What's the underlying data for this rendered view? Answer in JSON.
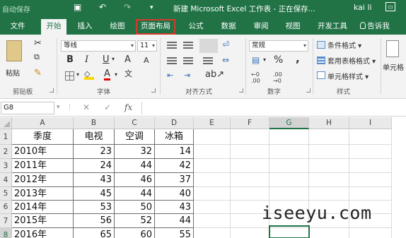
{
  "titlebar": {
    "autosave": "自动保存",
    "doc_title": "新建 Microsoft Excel 工作表 - 正在保存...",
    "user": "kai li"
  },
  "tabs": [
    "文件",
    "开始",
    "插入",
    "绘图",
    "页面布局",
    "公式",
    "数据",
    "审阅",
    "视图",
    "开发工具",
    "告诉我"
  ],
  "ribbon": {
    "paste_label": "粘贴",
    "clipboard_label": "剪贴板",
    "font_name": "等线",
    "font_size": "11",
    "bold": "B",
    "italic": "I",
    "underline": "U",
    "grow_font": "A",
    "shrink_font": "A",
    "font_color_glyph": "A",
    "phonetic_glyph": "文",
    "font_label": "字体",
    "alignment_label": "对齐方式",
    "number_format": "常规",
    "percent": "%",
    "comma": ",",
    "inc_decimal": "←0 .00",
    "dec_decimal": ".00 →0",
    "number_label": "数字",
    "conditional_format": "条件格式",
    "format_as_table": "套用表格格式",
    "cell_styles": "单元格样式",
    "styles_label": "样式",
    "cells_label": "单元格"
  },
  "formula_bar": {
    "name_box": "G8",
    "cancel": "✕",
    "enter": "✓",
    "fx": "fx",
    "formula": ""
  },
  "grid": {
    "columns": [
      "A",
      "B",
      "C",
      "D",
      "E",
      "F",
      "G",
      "H",
      "I"
    ],
    "rows": [
      "1",
      "2",
      "3",
      "4",
      "5",
      "6",
      "7",
      "8"
    ],
    "header_cells": [
      "季度",
      "电视",
      "空调",
      "冰箱"
    ],
    "data_rows": [
      [
        "2010年",
        "23",
        "32",
        "14"
      ],
      [
        "2011年",
        "24",
        "44",
        "42"
      ],
      [
        "2012年",
        "43",
        "46",
        "37"
      ],
      [
        "2013年",
        "45",
        "44",
        "40"
      ],
      [
        "2014年",
        "53",
        "50",
        "43"
      ],
      [
        "2015年",
        "56",
        "52",
        "44"
      ],
      [
        "2016年",
        "65",
        "60",
        "55"
      ]
    ]
  },
  "watermark": "iseeyu.com",
  "colors": {
    "excel_green": "#217346",
    "highlight_red": "#d23b2c",
    "ribbon_bg": "#f3f3f3"
  }
}
